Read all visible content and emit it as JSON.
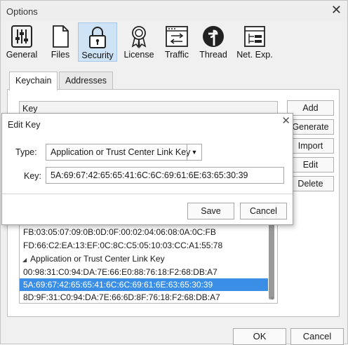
{
  "window": {
    "title": "Options"
  },
  "toolbar": {
    "items": [
      {
        "label": "General",
        "icon": "sliders-icon"
      },
      {
        "label": "Files",
        "icon": "document-icon"
      },
      {
        "label": "Security",
        "icon": "lock-icon"
      },
      {
        "label": "License",
        "icon": "award-ribbon-icon"
      },
      {
        "label": "Traffic",
        "icon": "traffic-window-icon"
      },
      {
        "label": "Thread",
        "icon": "thread-logo-icon"
      },
      {
        "label": "Net. Exp.",
        "icon": "network-explorer-icon"
      }
    ],
    "active": "Security"
  },
  "tabs": [
    "Keychain",
    "Addresses"
  ],
  "keylist": {
    "header": "Key",
    "rows_above": [
      "FB:03:05:07:09:0B:0D:0F:00:02:04:06:08:0A:0C:FB",
      "FD:66:C2:EA:13:EF:0C:8C:C5:05:10:03:CC:A1:55:78"
    ],
    "group": "Application or Trust Center Link Key",
    "group_rows": [
      "00:98:31:C0:94:DA:7E:66:E0:88:76:18:F2:68:DB:A7",
      "5A:69:67:42:65:65:41:6C:6C:69:61:6E:63:65:30:39",
      "8D:9F:31:C0:94:DA:7E:66:6D:8F:76:18:F2:68:DB:A7"
    ]
  },
  "side_buttons": [
    "Add",
    "Generate",
    "Import",
    "Edit",
    "Delete"
  ],
  "footer": {
    "ok": "OK",
    "cancel": "Cancel"
  },
  "dialog": {
    "title": "Edit Key",
    "type_label": "Type:",
    "type_value": "Application or Trust Center Link Key",
    "key_label": "Key:",
    "key_value": "5A:69:67:42:65:65:41:6C:6C:69:61:6E:63:65:30:39",
    "save": "Save",
    "cancel": "Cancel"
  },
  "colors": {
    "selection": "#3a8ee6",
    "active_tool": "#cfe3f7"
  }
}
